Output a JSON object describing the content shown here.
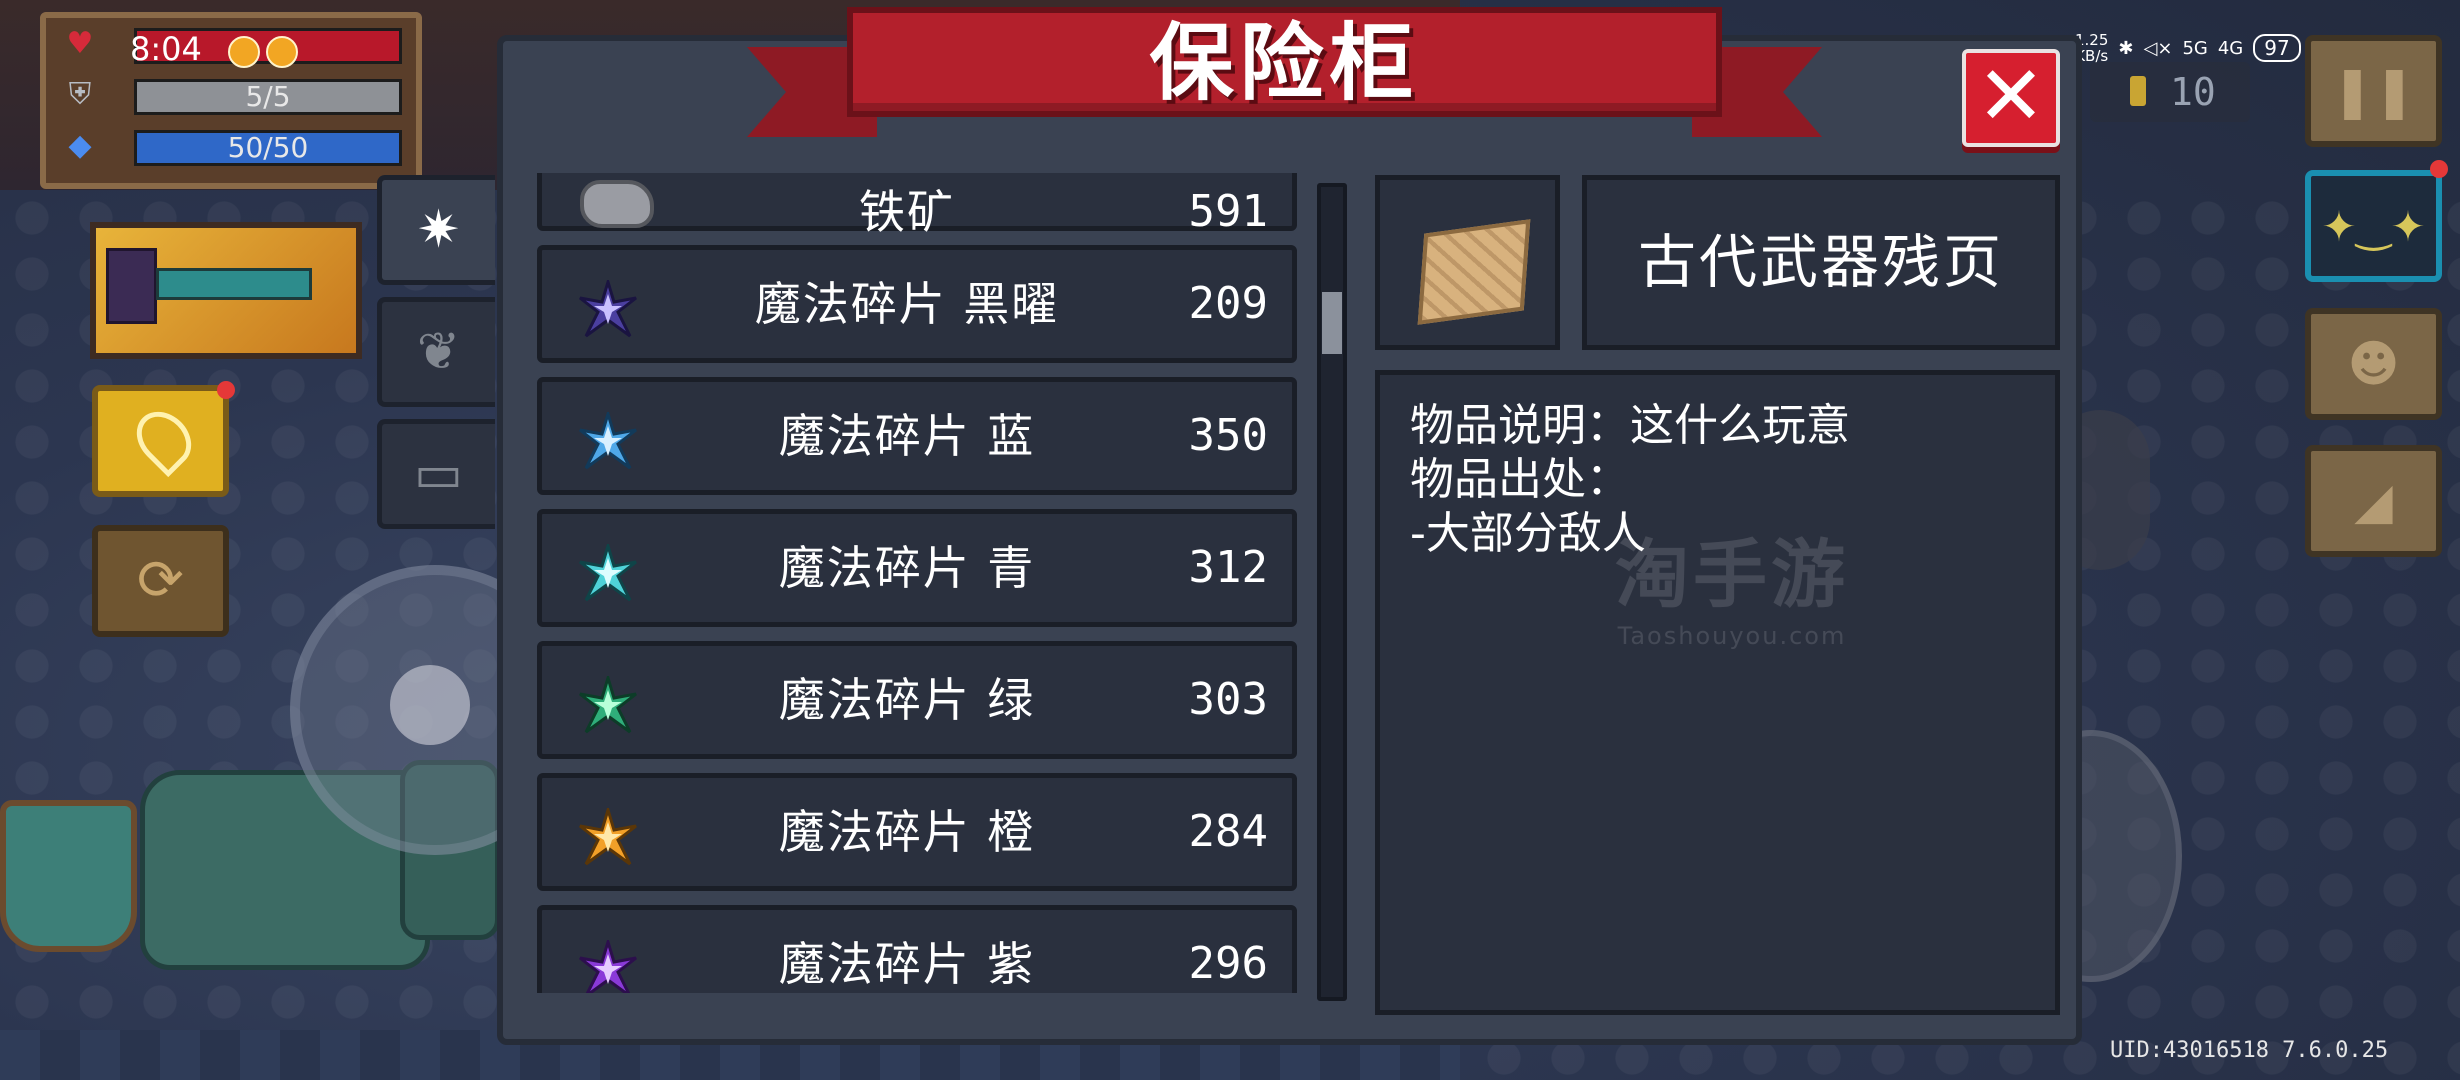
{
  "hud": {
    "clock": "8:04",
    "hp": "",
    "armor": "5/5",
    "mana": "50/50"
  },
  "status_bar": {
    "speed_top": "1.25",
    "speed_bottom": "KB/s",
    "net1": "5G",
    "net2": "4G",
    "battery": "97"
  },
  "coins": "10",
  "uid": "UID:43016518 7.6.0.25",
  "dialog": {
    "title": "保险柜",
    "close": "✕",
    "tabs": [
      {
        "name": "materials",
        "glyph": "✷",
        "active": true
      },
      {
        "name": "plants",
        "glyph": "❦",
        "active": false
      },
      {
        "name": "tickets",
        "glyph": "▭",
        "active": false
      }
    ],
    "items": [
      {
        "name": "铁矿",
        "count": "591",
        "icon": "iron-ore-icon"
      },
      {
        "name": "魔法碎片 黑曜",
        "count": "209",
        "icon": "shard-obsidian-icon",
        "color": "#4b3fa0"
      },
      {
        "name": "魔法碎片 蓝",
        "count": "350",
        "icon": "shard-blue-icon",
        "color": "#4fa8e8"
      },
      {
        "name": "魔法碎片 青",
        "count": "312",
        "icon": "shard-cyan-icon",
        "color": "#4fd2d8"
      },
      {
        "name": "魔法碎片 绿",
        "count": "303",
        "icon": "shard-green-icon",
        "color": "#2fae7a"
      },
      {
        "name": "魔法碎片 橙",
        "count": "284",
        "icon": "shard-orange-icon",
        "color": "#f2a028"
      },
      {
        "name": "魔法碎片 紫",
        "count": "296",
        "icon": "shard-purple-icon",
        "color": "#8a3ad8"
      }
    ],
    "detail": {
      "name": "古代武器残页",
      "icon": "ancient-page-icon",
      "lines": [
        "物品说明：这什么玩意",
        "物品出处：",
        "-大部分敌人"
      ]
    }
  },
  "watermark": {
    "cn": "淘手游",
    "en": "Taoshouyou.com"
  }
}
